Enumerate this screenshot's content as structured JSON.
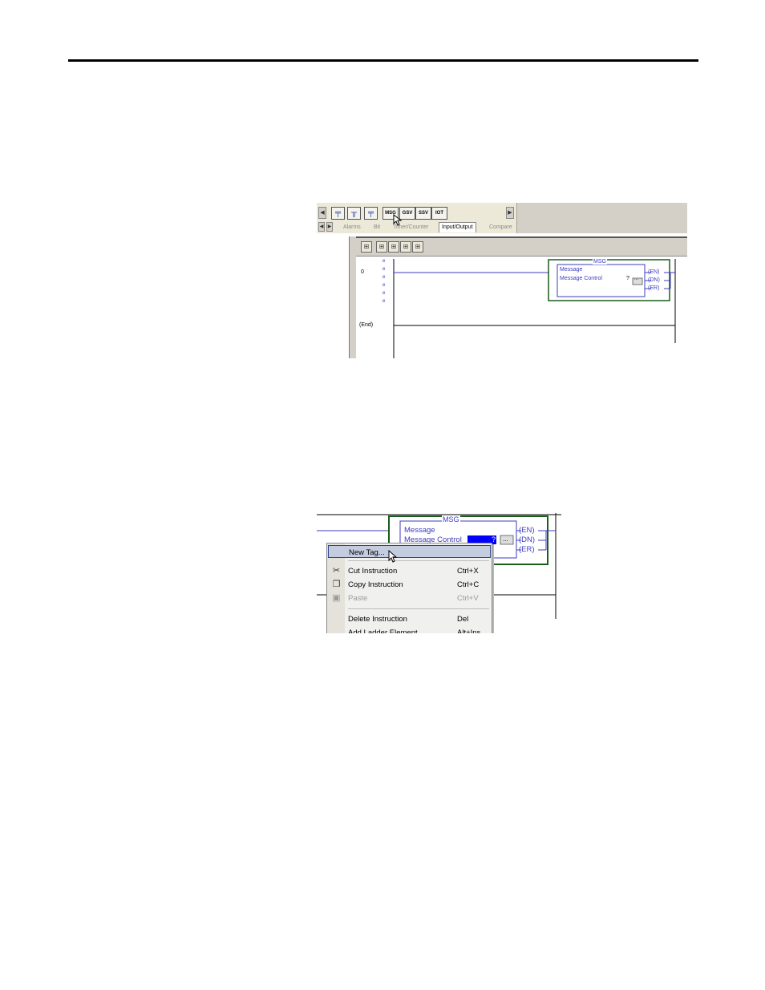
{
  "screenshot1": {
    "toolbar": {
      "buttons": [
        {
          "kind": "icon",
          "name": "rung-branch-icon"
        },
        {
          "kind": "icon",
          "name": "branch-icon"
        },
        {
          "kind": "icon",
          "name": "branch-level-icon"
        },
        {
          "kind": "label",
          "label": "MSG"
        },
        {
          "kind": "label",
          "label": "GSV"
        },
        {
          "kind": "label",
          "label": "SSV"
        },
        {
          "kind": "label",
          "label": "IOT"
        }
      ],
      "tabs": [
        "Alarms",
        "Bit",
        "Timer/Counter",
        "Input/Output",
        "Compare"
      ],
      "active_tab": "Input/Output"
    },
    "ladder": {
      "rung_number": "0",
      "e_marks": [
        "e",
        "e",
        "e",
        "e",
        "e",
        "e"
      ],
      "end_label": "(End)",
      "instruction": {
        "title": "MSG",
        "line1": "Message",
        "line2_label": "Message Control",
        "line2_value": "?",
        "browse": "...",
        "outputs": [
          "EN",
          "DN",
          "ER"
        ]
      }
    }
  },
  "screenshot2": {
    "instruction": {
      "title": "MSG",
      "line1": "Message",
      "line2_label": "Message Control",
      "line2_value": "?",
      "browse": "...",
      "outputs": [
        "EN",
        "DN",
        "ER"
      ]
    },
    "context_menu": {
      "items": [
        {
          "label": "New Tag...",
          "shortcut": "",
          "highlighted": true,
          "disabled": false,
          "icon": ""
        },
        {
          "label": "Cut Instruction",
          "shortcut": "Ctrl+X",
          "highlighted": false,
          "disabled": false,
          "icon": "scissors-icon"
        },
        {
          "label": "Copy Instruction",
          "shortcut": "Ctrl+C",
          "highlighted": false,
          "disabled": false,
          "icon": "copy-icon"
        },
        {
          "label": "Paste",
          "shortcut": "Ctrl+V",
          "highlighted": false,
          "disabled": true,
          "icon": "paste-icon"
        },
        {
          "label": "Delete Instruction",
          "shortcut": "Del",
          "highlighted": false,
          "disabled": false,
          "icon": ""
        },
        {
          "label": "Add Ladder Element",
          "shortcut": "Alt+Ins",
          "highlighted": false,
          "disabled": false,
          "icon": ""
        }
      ]
    }
  },
  "colors": {
    "wire": "#3b3bbf",
    "instruction_border": "#1a5c1a",
    "toolbar_bg": "#d4d0c8",
    "menu_highlight": "#c4cce0",
    "selection_blue": "#0000ff"
  }
}
